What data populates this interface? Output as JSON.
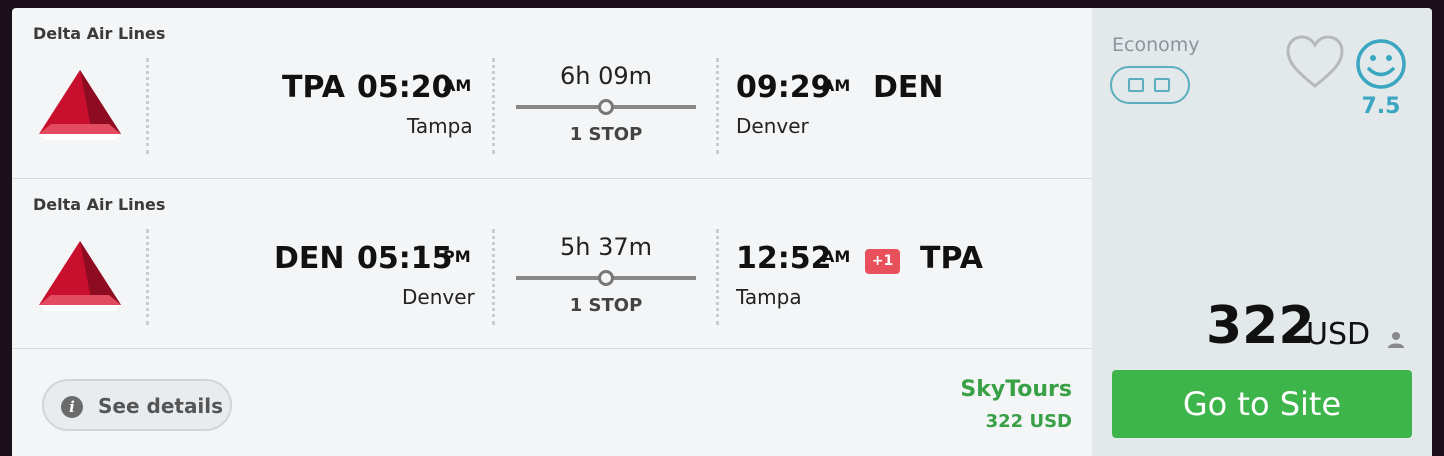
{
  "legs": [
    {
      "airline": "Delta Air Lines",
      "origin_code": "TPA",
      "dep_time": "05:20",
      "dep_ampm": "AM",
      "origin_city": "Tampa",
      "duration": "6h 09m",
      "stops": "1 STOP",
      "arr_time": "09:29",
      "arr_ampm": "AM",
      "dest_code": "DEN",
      "dest_city": "Denver"
    },
    {
      "airline": "Delta Air Lines",
      "origin_code": "DEN",
      "dep_time": "05:15",
      "dep_ampm": "PM",
      "origin_city": "Denver",
      "duration": "5h 37m",
      "stops": "1 STOP",
      "arr_time": "12:52",
      "arr_ampm": "AM",
      "day_offset": "+1",
      "dest_code": "TPA",
      "dest_city": "Tampa"
    }
  ],
  "footer": {
    "details_label": "See details",
    "provider_name": "SkyTours",
    "provider_price": "322 USD"
  },
  "side": {
    "cabin": "Economy",
    "score": "7.5",
    "price": "322",
    "currency": "USD",
    "cta_label": "Go to Site"
  },
  "colors": {
    "accent_green": "#3eb54a",
    "score_blue": "#3aa6c2",
    "badge_red": "#e8505b",
    "delta_red": "#c8102e"
  },
  "icons": [
    "delta-logo-icon",
    "carry-on-bag-icon",
    "checked-bag-icon",
    "heart-icon",
    "smiley-icon",
    "info-icon",
    "person-icon"
  ]
}
